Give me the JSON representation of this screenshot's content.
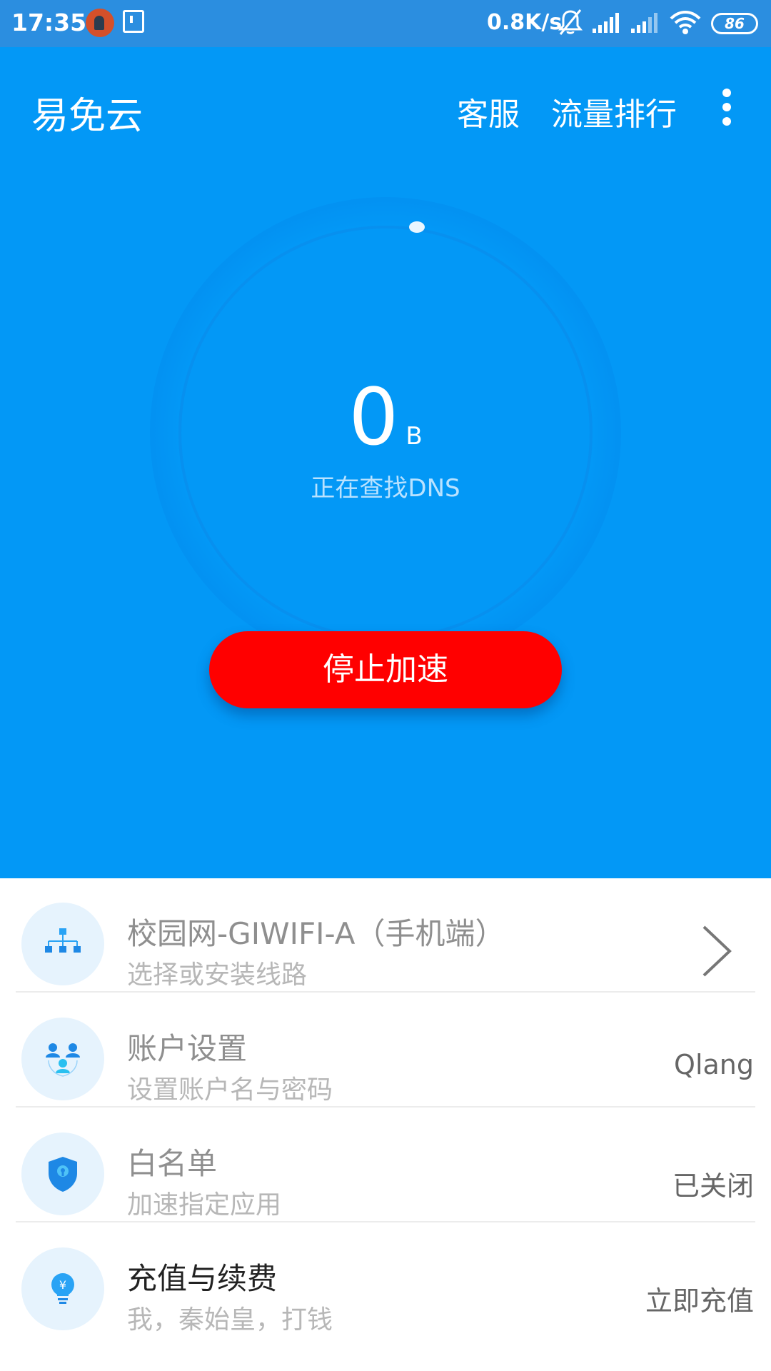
{
  "status_bar": {
    "time": "17:35",
    "net_speed": "0.8K/s",
    "battery": "86",
    "icons": [
      "app-icon",
      "notification-box-icon",
      "mute-icon",
      "signal-icon",
      "signal-icon",
      "wifi-icon",
      "battery-icon"
    ]
  },
  "header": {
    "title": "易免云",
    "actions": [
      "客服",
      "流量排行"
    ],
    "more_icon": "more-vertical-icon"
  },
  "meter": {
    "value": "0",
    "unit": "B",
    "status": "正在查找DNS"
  },
  "primary_button": {
    "label": "停止加速",
    "color": "#ff0000"
  },
  "list": [
    {
      "icon": "network-tree-icon",
      "title": "校园网-GIWIFI-A（手机端）",
      "subtitle": "选择或安装线路",
      "value": "",
      "chevron": true
    },
    {
      "icon": "users-icon",
      "title": "账户设置",
      "subtitle": "设置账户名与密码",
      "value": "Qlang"
    },
    {
      "icon": "shield-lock-icon",
      "title": "白名单",
      "subtitle": "加速指定应用",
      "value": "已关闭"
    },
    {
      "icon": "bulb-yen-icon",
      "title": "充值与续费",
      "subtitle": "我，秦始皇，打钱",
      "value": "立即充值"
    }
  ],
  "colors": {
    "hero_bg": "#0398f6",
    "status_bar_bg": "#2b8ee0",
    "icon_bg": "#e6f3fd",
    "icon_blue": "#1e88e5"
  }
}
